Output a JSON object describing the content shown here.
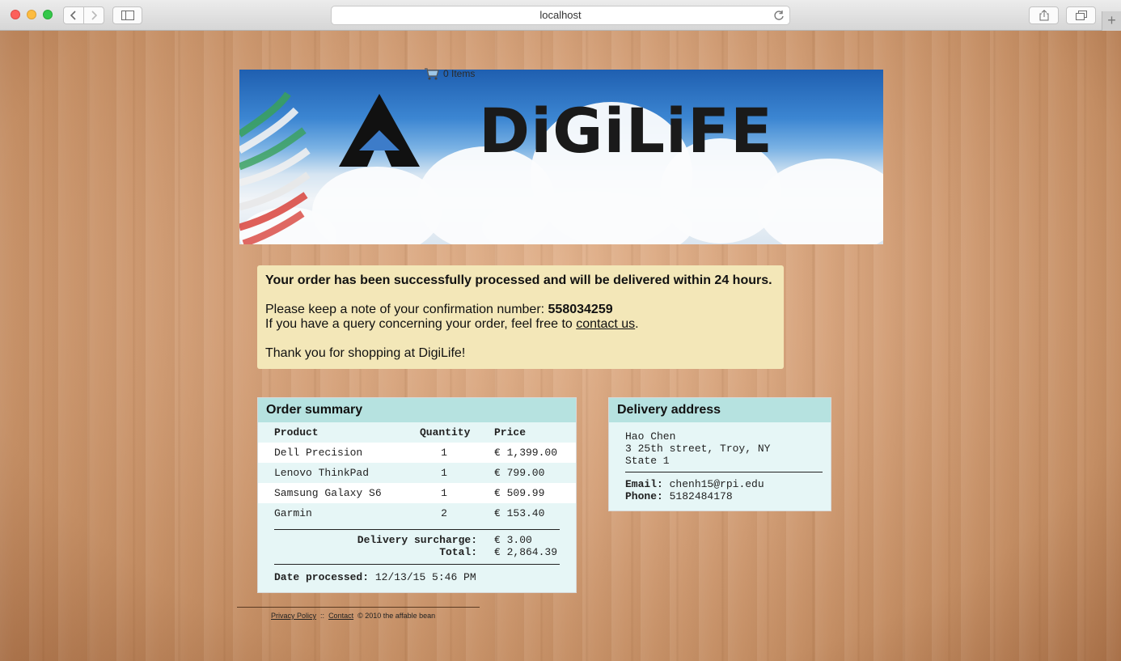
{
  "browser": {
    "url": "localhost"
  },
  "header": {
    "cart_count": "0 Items",
    "logo_text": "DiGiLiFE"
  },
  "confirmation": {
    "headline": "Your order has been successfully processed and will be delivered within 24 hours.",
    "note_prefix": "Please keep a note of your confirmation number: ",
    "confirmation_number": "558034259",
    "query_prefix": "If you have a query concerning your order, feel free to ",
    "contact_link": "contact us",
    "query_suffix": ".",
    "thanks": "Thank you for shopping at DigiLife!"
  },
  "order_summary": {
    "title": "Order summary",
    "columns": [
      "Product",
      "Quantity",
      "Price"
    ],
    "items": [
      {
        "product": "Dell Precision",
        "quantity": "1",
        "price": "€ 1,399.00"
      },
      {
        "product": "Lenovo ThinkPad",
        "quantity": "1",
        "price": "€ 799.00"
      },
      {
        "product": "Samsung Galaxy S6",
        "quantity": "1",
        "price": "€ 509.99"
      },
      {
        "product": "Garmin",
        "quantity": "2",
        "price": "€ 153.40"
      }
    ],
    "surcharge_label": "Delivery surcharge:",
    "surcharge_value": "€ 3.00",
    "total_label": "Total:",
    "total_value": "€ 2,864.39",
    "date_label": "Date processed:",
    "date_value": "12/13/15 5:46 PM"
  },
  "delivery": {
    "title": "Delivery address",
    "name": "Hao Chen",
    "street": "3 25th street, Troy, NY",
    "state": "State 1",
    "email_label": "Email:",
    "email": "chenh15@rpi.edu",
    "phone_label": "Phone:",
    "phone": "5182484178"
  },
  "footer": {
    "privacy": "Privacy Policy",
    "separator": "::",
    "contact": "Contact",
    "copyright": "©  2010 the affable bean"
  }
}
